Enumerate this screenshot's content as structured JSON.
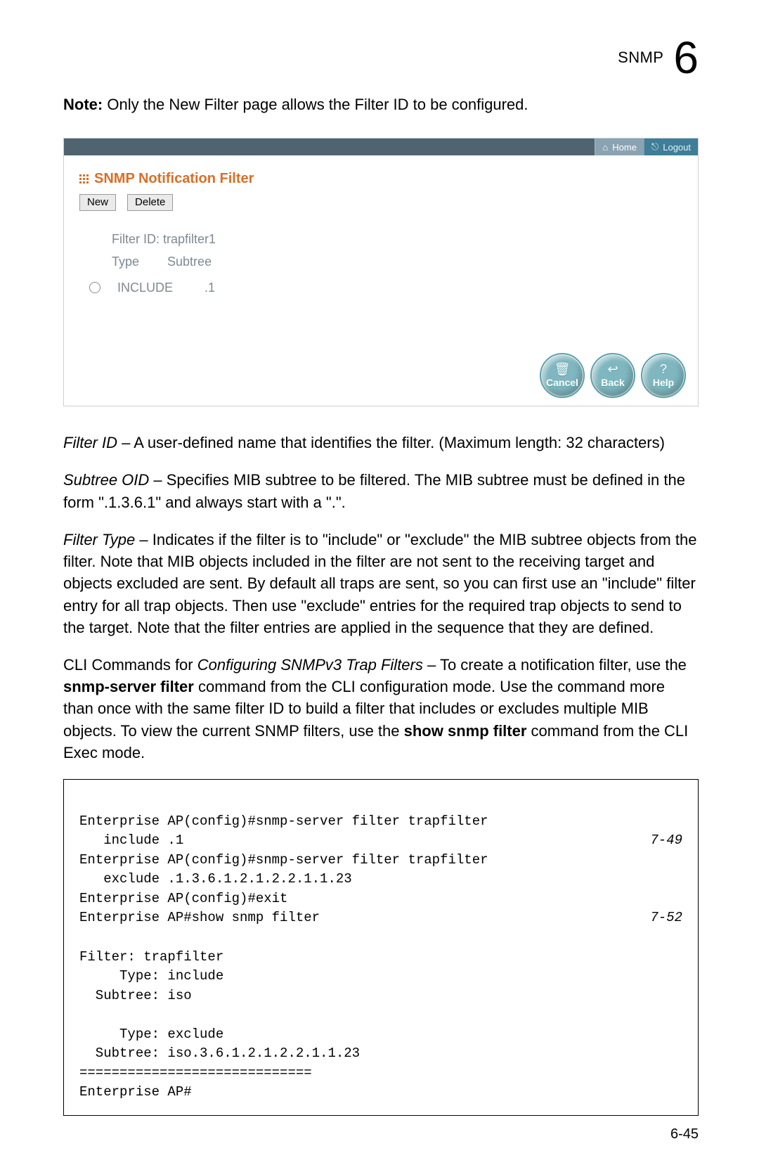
{
  "header": {
    "breadcrumb": "SNMP",
    "chapter_number": "6"
  },
  "note": {
    "label": "Note:",
    "text": "Only the New Filter page allows the Filter ID to be configured."
  },
  "ui": {
    "topbar": {
      "home_label": "Home",
      "logout_label": "Logout"
    },
    "title": "SNMP Notification Filter",
    "buttons": {
      "new": "New",
      "delete": "Delete"
    },
    "details": {
      "filter_id_label": "Filter ID:",
      "filter_id_value": "trapfilter1",
      "col_type": "Type",
      "col_subtree": "Subtree",
      "row_type": "INCLUDE",
      "row_subtree": ".1"
    },
    "round_buttons": {
      "cancel": "Cancel",
      "back": "Back",
      "help": "Help"
    }
  },
  "paras": {
    "p1_term": "Filter ID",
    "p1_rest": " – A user-defined name that identifies the filter. (Maximum length: 32 characters)",
    "p2_term": "Subtree OID",
    "p2_rest": " – Specifies MIB subtree to be filtered. The MIB subtree must be defined in the form \".1.3.6.1\" and always start with a \".\".",
    "p3_term": "Filter Type",
    "p3_rest": " – Indicates if the filter is to \"include\" or \"exclude\" the MIB subtree objects from the filter. Note that MIB objects included in the filter are not sent to the receiving target and objects excluded are sent. By default all traps are sent, so you can first use an \"include\" filter entry for all trap objects. Then use \"exclude\" entries for the required trap objects to send to the target. Note that the filter entries are applied in the sequence that they are defined.",
    "p4_pre": "CLI Commands for ",
    "p4_em": "Configuring SNMPv3 Trap Filters",
    "p4_mid_a": " – To create a notification filter, use the ",
    "p4_bold_a": "snmp-server filter",
    "p4_mid_b": " command from the CLI configuration mode. Use the command more than once with the same filter ID to build a filter that includes or excludes multiple MIB objects. To view the current SNMP filters, use the ",
    "p4_bold_b": "show snmp filter",
    "p4_mid_c": " command from the CLI Exec mode."
  },
  "cli": {
    "l1": "Enterprise AP(config)#snmp-server filter trapfilter",
    "l2": "   include .1",
    "ref1": "7-49",
    "l3": "Enterprise AP(config)#snmp-server filter trapfilter",
    "l4": "   exclude .1.3.6.1.2.1.2.2.1.1.23",
    "l5": "Enterprise AP(config)#exit",
    "l6": "Enterprise AP#show snmp filter",
    "ref2": "7-52",
    "blank": "",
    "l7": "Filter: trapfilter",
    "l8": "     Type: include",
    "l9": "  Subtree: iso",
    "l10": "     Type: exclude",
    "l11": "  Subtree: iso.3.6.1.2.1.2.2.1.1.23",
    "l12": "=============================",
    "l13": "Enterprise AP#"
  },
  "page_number": "6-45"
}
